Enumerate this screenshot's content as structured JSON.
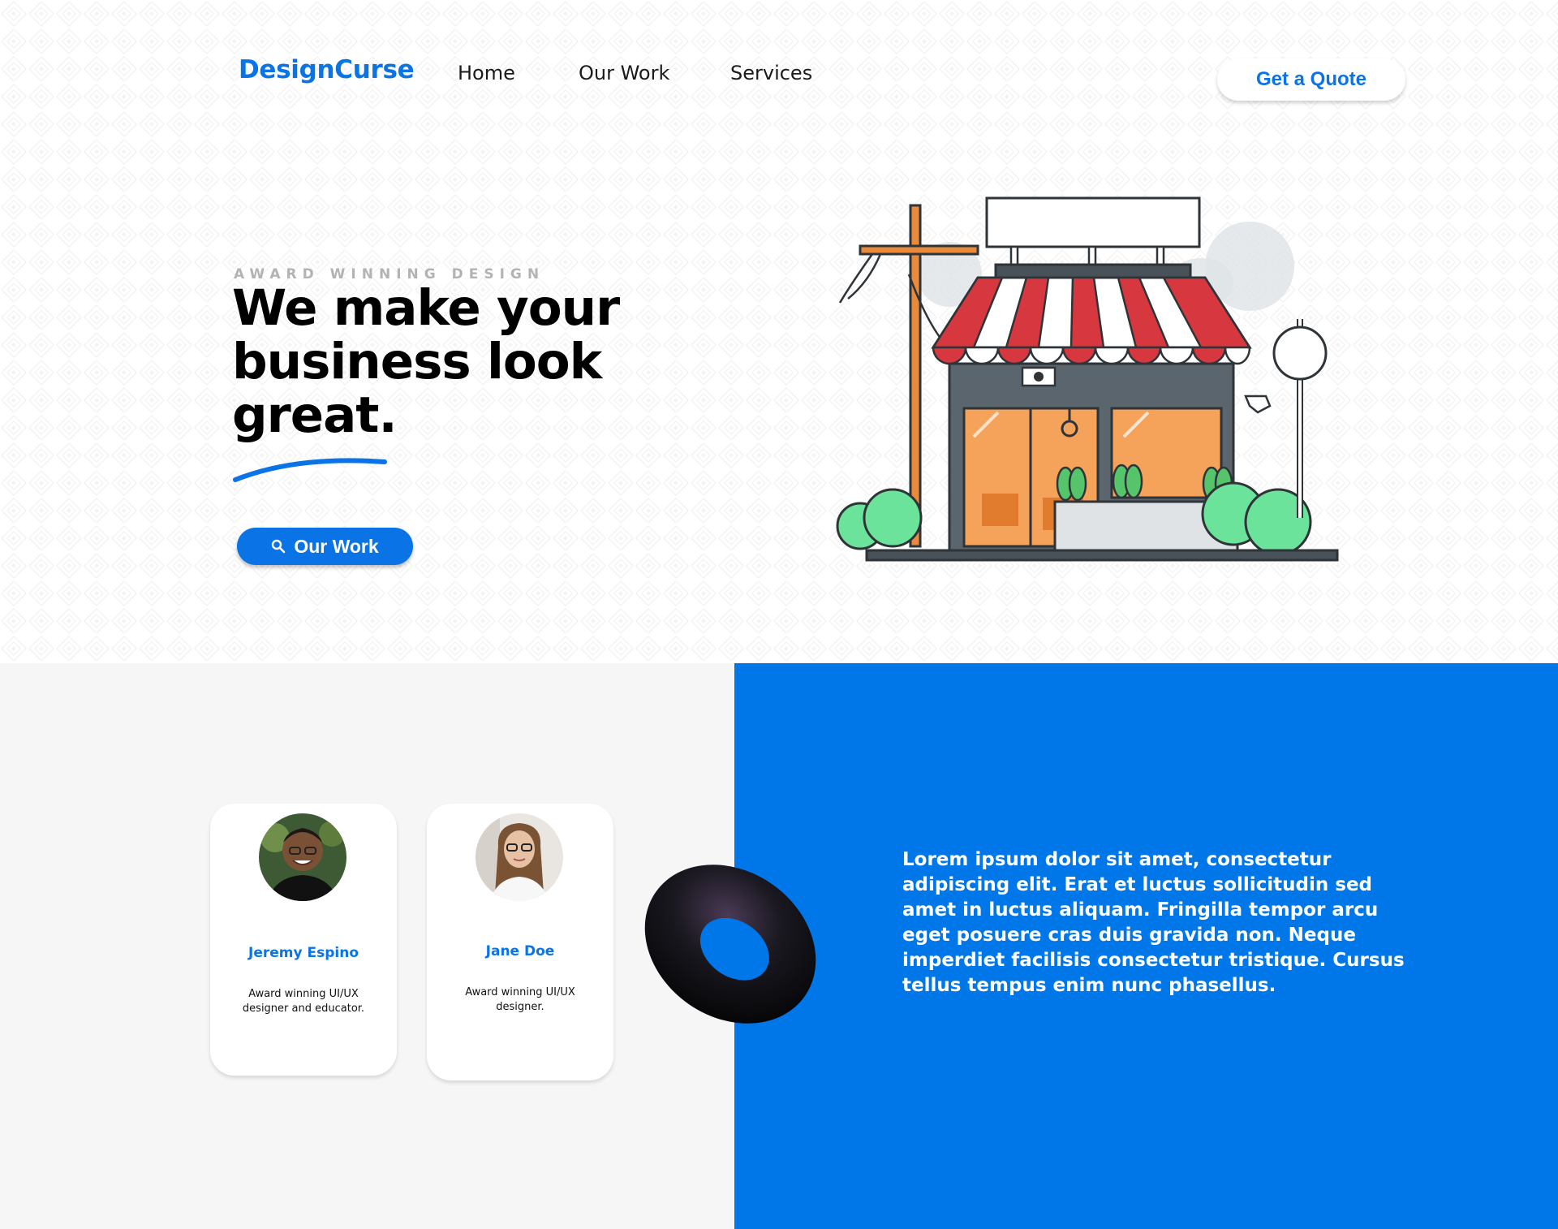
{
  "header": {
    "logo": "DesignCurse",
    "nav": [
      "Home",
      "Our Work",
      "Services"
    ],
    "cta": "Get a Quote"
  },
  "hero": {
    "eyebrow": "AWARD WINNING DESIGN",
    "headline_lines": [
      "We make your",
      "business look",
      "great."
    ],
    "button_label": "Our Work",
    "button_icon": "search-icon"
  },
  "team": [
    {
      "name": "Jeremy Espino",
      "desc_lines": [
        "Award winning UI/UX",
        "designer and educator."
      ]
    },
    {
      "name": "Jane Doe",
      "desc_lines": [
        "Award winning UI/UX",
        "designer."
      ]
    }
  ],
  "about": {
    "text_lines": [
      "Lorem ipsum dolor sit amet, consectetur",
      "adipiscing elit. Erat et luctus sollicitudin sed",
      "amet in luctus aliquam. Fringilla tempor arcu",
      "eget posuere cras duis gravida non. Neque",
      "imperdiet facilisis consectetur tristique. Cursus",
      "tellus tempus enim nunc phasellus."
    ]
  },
  "colors": {
    "brand_blue": "#0a74e6",
    "panel_blue": "#0077e8",
    "team_bg": "#f6f6f6",
    "awning_red": "#d7373f"
  }
}
